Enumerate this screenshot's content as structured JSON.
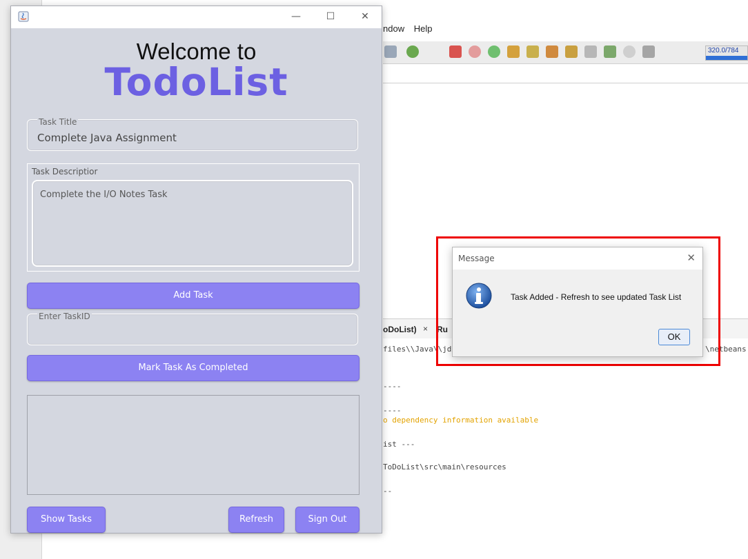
{
  "ide": {
    "menu": [
      "ndow",
      "Help"
    ],
    "progress_text": "320.0/784",
    "output_tab_label": "oDoList)",
    "output_tab_close": "×",
    "output_tab_run": "Ru",
    "output_lines": [
      "files\\\\Java\\\\jd",
      "----",
      "----",
      "o dependency information available",
      "ist ---",
      "ToDoList\\src\\main\\resources",
      "--",
      "\\netbeans"
    ]
  },
  "app": {
    "window_controls": {
      "minimize": "—",
      "maximize": "☐",
      "close": "✕"
    },
    "welcome": "Welcome to",
    "brand": "TodoList",
    "brand_color": "#6c60e2",
    "task_title": {
      "label": "Task Title",
      "value": "Complete Java Assignment"
    },
    "task_description": {
      "label": "Task Descriptior",
      "value": "Complete the I/O Notes Task"
    },
    "add_task": "Add Task",
    "task_id": {
      "label": "Enter TaskID",
      "value": ""
    },
    "mark_completed": "Mark Task As Completed",
    "show_tasks": "Show Tasks",
    "refresh": "Refresh",
    "sign_out": "Sign Out",
    "button_color": "#8c82f2"
  },
  "dialog": {
    "title": "Message",
    "close": "✕",
    "icon": "info-icon",
    "message": "Task Added - Refresh to see updated Task List",
    "ok": "OK"
  }
}
